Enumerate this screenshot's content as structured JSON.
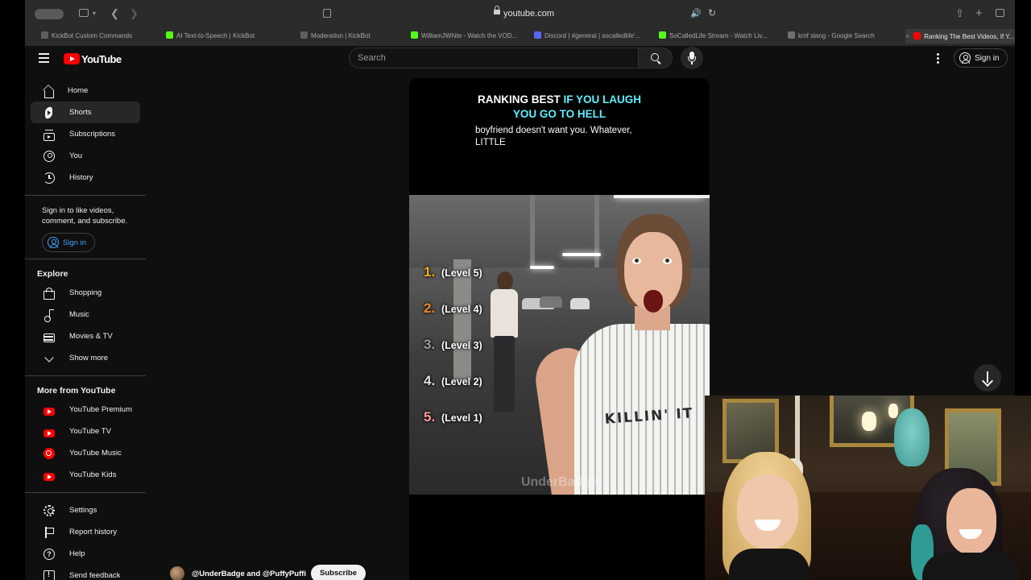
{
  "browser": {
    "url_domain": "youtube.com",
    "tabs": [
      {
        "label": "KickBot Custom Commands",
        "color": "#5f5f5f"
      },
      {
        "label": "AI Text-to-Speech | KickBot",
        "color": "#53fc18"
      },
      {
        "label": "Moderation | KickBot",
        "color": "#5f5f5f"
      },
      {
        "label": "WilliamJWhite - Watch the VOD...",
        "color": "#53fc18"
      },
      {
        "label": "Discord | #general | socalledlife'...",
        "color": "#5865f2"
      },
      {
        "label": "SoCalledLife Stream - Watch Liv...",
        "color": "#53fc18"
      },
      {
        "label": "kmf slang - Google Search",
        "color": "#6f6f6f"
      },
      {
        "label": "Ranking The Best Videos, If Y...",
        "color": "#ff0000"
      }
    ]
  },
  "youtube": {
    "logo_text": "YouTube",
    "search_placeholder": "Search",
    "signin_label": "Sign in",
    "sidebar": {
      "main": [
        {
          "label": "Home",
          "icon": "home-icon"
        },
        {
          "label": "Shorts",
          "icon": "shorts-icon",
          "active": true
        },
        {
          "label": "Subscriptions",
          "icon": "subscriptions-icon"
        },
        {
          "label": "You",
          "icon": "you-icon"
        },
        {
          "label": "History",
          "icon": "history-icon"
        }
      ],
      "signin_note": "Sign in to like videos, comment, and subscribe.",
      "signin_button": "Sign in",
      "explore_title": "Explore",
      "explore": [
        {
          "label": "Shopping",
          "icon": "shopping-bag-icon"
        },
        {
          "label": "Music",
          "icon": "music-note-icon"
        },
        {
          "label": "Movies & TV",
          "icon": "film-icon"
        },
        {
          "label": "Show more",
          "icon": "chevron-down-icon"
        }
      ],
      "more_title": "More from YouTube",
      "more": [
        {
          "label": "YouTube Premium",
          "icon": "youtube-premium-icon"
        },
        {
          "label": "YouTube TV",
          "icon": "youtube-tv-icon"
        },
        {
          "label": "YouTube Music",
          "icon": "youtube-music-icon"
        },
        {
          "label": "YouTube Kids",
          "icon": "youtube-kids-icon"
        }
      ],
      "footer": [
        {
          "label": "Settings",
          "icon": "gear-icon"
        },
        {
          "label": "Report history",
          "icon": "flag-icon"
        },
        {
          "label": "Help",
          "icon": "help-icon"
        },
        {
          "label": "Send feedback",
          "icon": "feedback-icon"
        }
      ]
    },
    "short": {
      "title_plain": "RANKING BEST ",
      "title_highlight_1": "IF YOU",
      "title_highlight_2": "LAUGH YOU GO TO HELL",
      "subtitle": "boyfriend doesn't want you. Whatever, LITTLE",
      "levels": [
        {
          "num": "1.",
          "label": "(Level 5)",
          "color": "#f5b400"
        },
        {
          "num": "2.",
          "label": "(Level 4)",
          "color": "#f08a24"
        },
        {
          "num": "3.",
          "label": "(Level 3)",
          "color": "#a0a0a0"
        },
        {
          "num": "4.",
          "label": "(Level 2)",
          "color": "#e0e0e0"
        },
        {
          "num": "5.",
          "label": "(Level 1)",
          "color": "#ff9a9a"
        }
      ],
      "shirt_text": "KILLIN' IT",
      "watermark": "UnderBadge",
      "channel": "@UnderBadge and @PuffyPuffi",
      "subscribe_label": "Subscribe"
    }
  }
}
